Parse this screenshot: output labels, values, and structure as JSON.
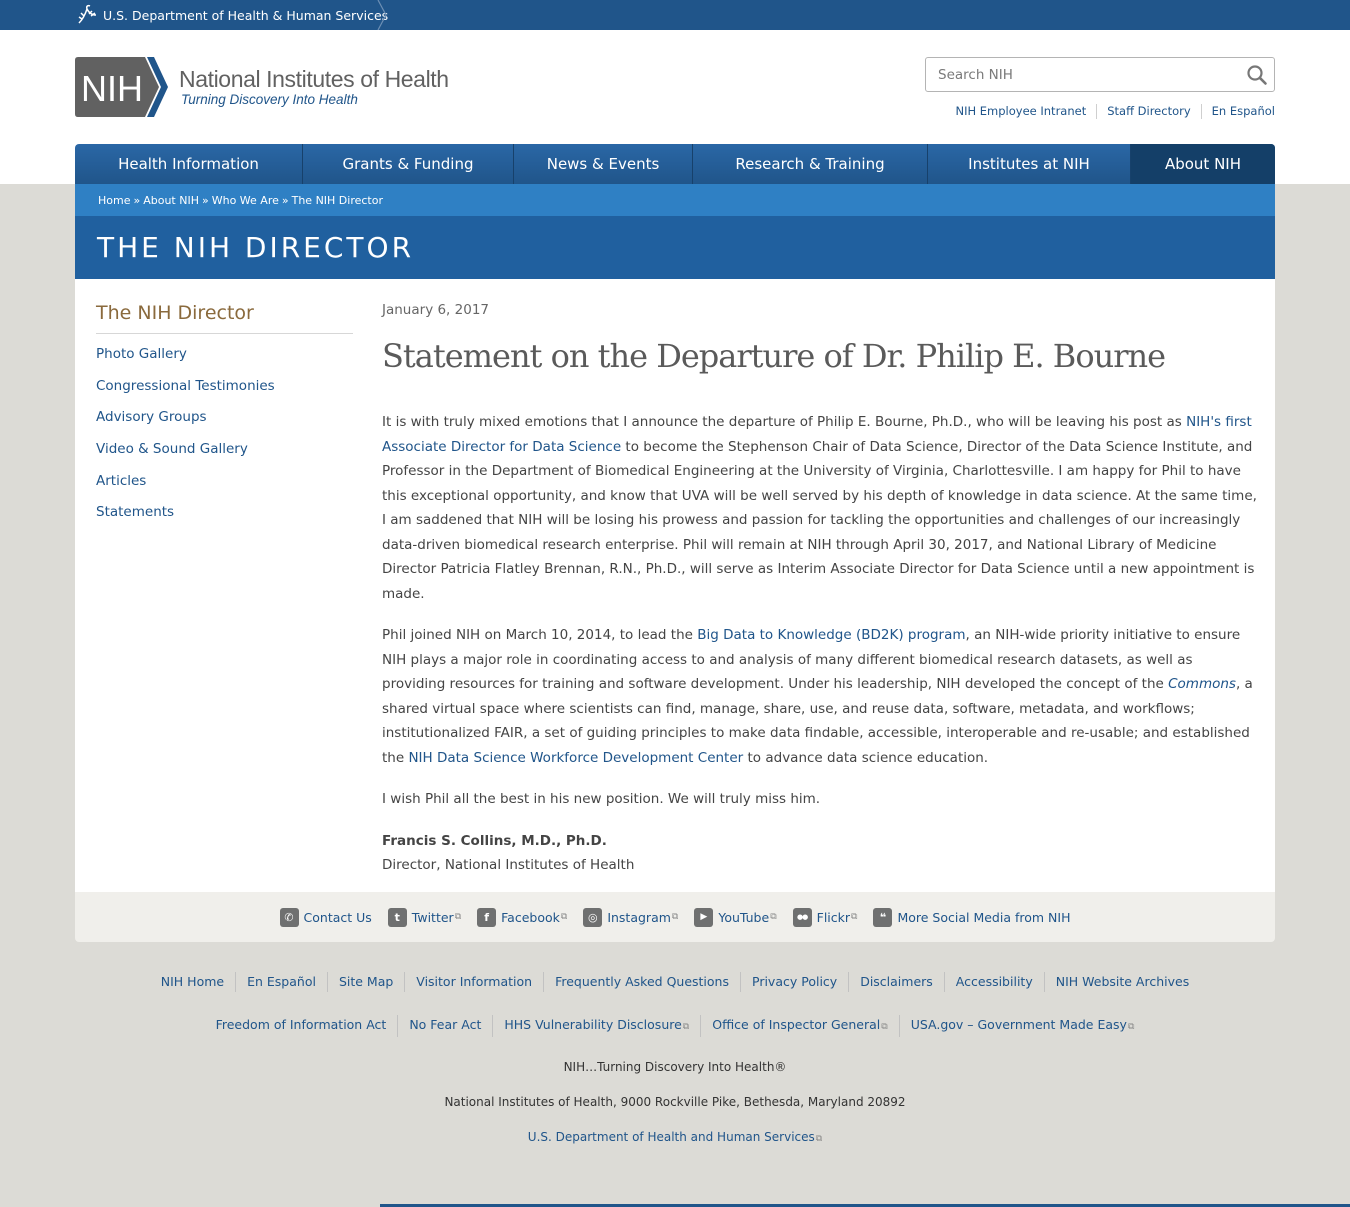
{
  "hhs": {
    "label": "U.S. Department of Health & Human Services"
  },
  "logo": {
    "mark": "NIH",
    "title": "National Institutes of Health",
    "tagline": "Turning Discovery Into Health"
  },
  "search": {
    "placeholder": "Search NIH"
  },
  "utility_links": [
    "NIH Employee Intranet",
    "Staff Directory",
    "En Español"
  ],
  "nav": [
    {
      "label": "Health Information"
    },
    {
      "label": "Grants & Funding"
    },
    {
      "label": "News & Events"
    },
    {
      "label": "Research & Training"
    },
    {
      "label": "Institutes at NIH"
    },
    {
      "label": "About NIH",
      "active": true
    }
  ],
  "breadcrumb": [
    "Home",
    "About NIH",
    "Who We Are",
    "The NIH Director"
  ],
  "breadcrumb_sep": "»",
  "page_title": "THE NIH DIRECTOR",
  "sidebar": {
    "title": "The NIH Director",
    "items": [
      "Photo Gallery",
      "Congressional Testimonies",
      "Advisory Groups",
      "Video & Sound Gallery",
      "Articles",
      "Statements"
    ]
  },
  "article": {
    "date": "January 6, 2017",
    "headline": "Statement on the Departure of Dr. Philip E. Bourne",
    "p1": {
      "t1": "It is with truly mixed emotions that I announce the departure of Philip E. Bourne, Ph.D., who will be leaving his post as ",
      "link1": "NIH's first Associate Director for Data Science",
      "t2": " to become the Stephenson Chair of Data Science, Director of the Data Science Institute, and Professor in the Department of Biomedical Engineering at the University of Virginia, Charlottesville.  I am happy for Phil to have this exceptional opportunity, and know that UVA will be well served by his depth of knowledge in data science.  At the same time, I am saddened that NIH will be losing his prowess and passion for tackling the opportunities and challenges of our increasingly data-driven biomedical research enterprise.  Phil will remain at NIH through April 30, 2017, and National Library of Medicine Director Patricia Flatley Brennan, R.N., Ph.D., will serve as Interim Associate Director for Data Science until a new appointment is made."
    },
    "p2": {
      "t1": "Phil joined NIH on March 10, 2014, to lead the ",
      "link1": "Big Data to Knowledge (BD2K) program",
      "t2": ", an NIH-wide priority initiative to ensure NIH plays a major role in coordinating access to and analysis of many different biomedical research datasets, as well as providing resources for training and software development. Under his leadership, NIH developed the concept of the ",
      "link2": "Commons",
      "t3": ", a shared virtual space where scientists can find, manage, share, use, and reuse data, software, metadata, and workflows; institutionalized FAIR, a set of guiding principles to make data findable, accessible, interoperable and re-usable; and established the ",
      "link3": "NIH Data Science Workforce Development Center",
      "t4": " to advance data science education."
    },
    "p3": "I wish Phil all the best in his new position. We will truly miss him.",
    "signature_name": "Francis S. Collins, M.D., Ph.D.",
    "signature_role": "Director, National Institutes of Health"
  },
  "social": [
    {
      "label": "Contact Us",
      "icon": "phone-icon",
      "glyph": "✆",
      "external": false
    },
    {
      "label": "Twitter",
      "icon": "twitter-icon",
      "glyph": "t",
      "external": true
    },
    {
      "label": "Facebook",
      "icon": "facebook-icon",
      "glyph": "f",
      "external": true
    },
    {
      "label": "Instagram",
      "icon": "instagram-icon",
      "glyph": "◎",
      "external": true
    },
    {
      "label": "YouTube",
      "icon": "youtube-icon",
      "glyph": "▶",
      "external": true
    },
    {
      "label": "Flickr",
      "icon": "flickr-icon",
      "glyph": "●●",
      "external": true
    },
    {
      "label": "More Social Media from NIH",
      "icon": "chat-bubbles-icon",
      "glyph": "❝",
      "external": false
    }
  ],
  "footer_links_1": [
    "NIH Home",
    "En Español",
    "Site Map",
    "Visitor Information",
    "Frequently Asked Questions",
    "Privacy Policy",
    "Disclaimers",
    "Accessibility",
    "NIH Website Archives"
  ],
  "footer_links_2": [
    {
      "label": "Freedom of Information Act",
      "external": false
    },
    {
      "label": "No Fear Act",
      "external": false
    },
    {
      "label": "HHS Vulnerability Disclosure",
      "external": true
    },
    {
      "label": "Office of Inspector General",
      "external": true
    },
    {
      "label": "USA.gov – Government Made Easy",
      "external": true
    }
  ],
  "footer_tagline": "NIH…Turning Discovery Into Health®",
  "footer_address": "National Institutes of Health, 9000 Rockville Pike, Bethesda, Maryland 20892",
  "footer_hhs": "U.S. Department of Health and Human Services",
  "external_glyph": "⧉",
  "colors": {
    "primary": "#20558a",
    "breadcrumb": "#2f80c4",
    "title_band": "#20609f",
    "sidebar_title": "#8a6a3d"
  }
}
